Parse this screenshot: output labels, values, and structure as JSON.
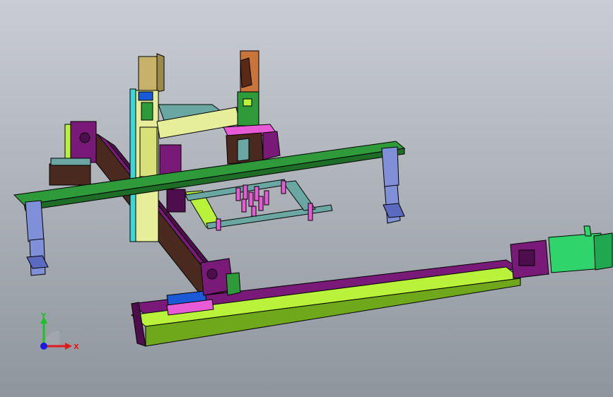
{
  "viewport": {
    "background_top": "#c9cdd3",
    "background_bottom": "#8f959d"
  },
  "triad": {
    "x_label": "X",
    "y_label": "Y",
    "x_color": "#e11b1b",
    "y_color": "#1fbf2a",
    "z_color": "#1b1be0"
  },
  "colors": {
    "frame_green": "#2e9a3a",
    "frame_green_dark": "#1d6d26",
    "rail_purple": "#7a1a78",
    "rail_purple_dark": "#4e0d4c",
    "rail_lime": "#b8f23a",
    "rail_lime_dark": "#6fa81a",
    "support_blue": "#7f8fd8",
    "cyan": "#3fd6d6",
    "brown": "#4a2a1e",
    "yellow_beam": "#e6ee9a",
    "pink": "#e85bd6",
    "motor_green": "#2fd46a",
    "orange": "#c9743a",
    "teal_plate": "#6aa7a2"
  }
}
